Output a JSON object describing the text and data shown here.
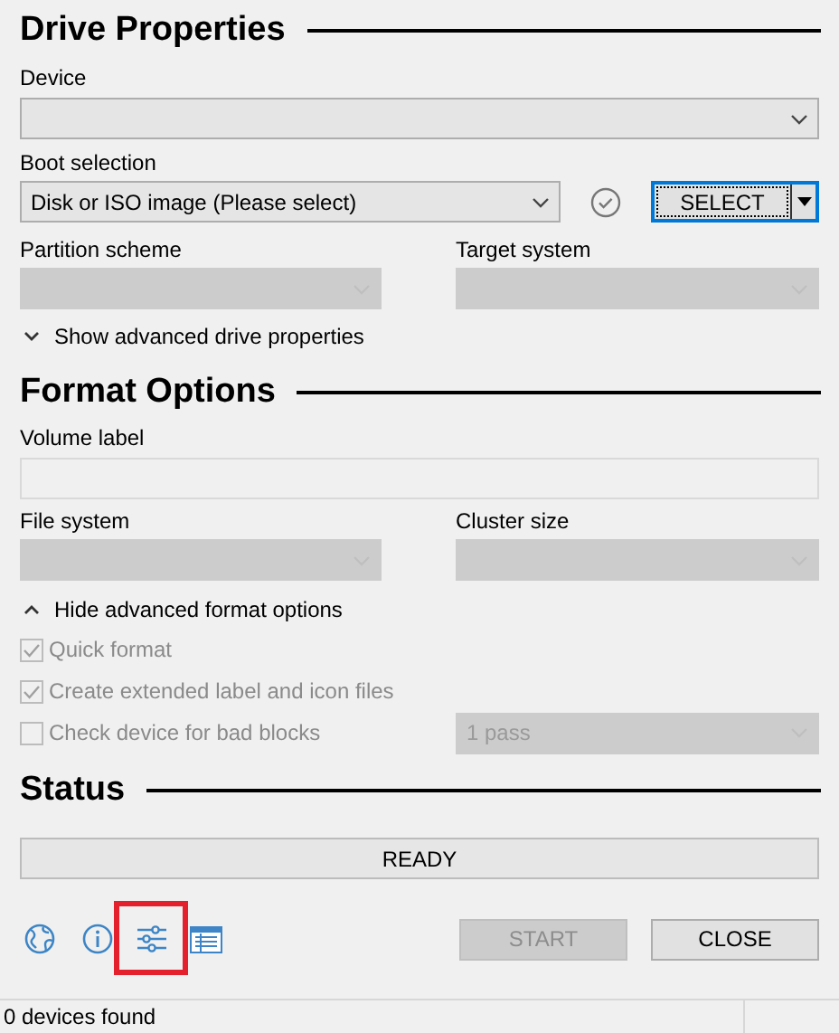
{
  "drive_properties": {
    "title": "Drive Properties",
    "device": {
      "label": "Device",
      "disabled": false
    },
    "boot_selection": {
      "label": "Boot selection",
      "value": "Disk or ISO image (Please select)",
      "disabled": false
    },
    "select_button": {
      "label": "SELECT",
      "focused": true
    },
    "partition_scheme": {
      "label": "Partition scheme",
      "disabled": true
    },
    "target_system": {
      "label": "Target system",
      "disabled": true
    },
    "advanced_toggle": {
      "label": "Show advanced drive properties",
      "expanded": false
    }
  },
  "format_options": {
    "title": "Format Options",
    "volume_label": {
      "label": "Volume label"
    },
    "file_system": {
      "label": "File system",
      "disabled": true
    },
    "cluster_size": {
      "label": "Cluster size",
      "disabled": true
    },
    "advanced_toggle": {
      "label": "Hide advanced format options",
      "expanded": true
    },
    "checkboxes": [
      {
        "label": "Quick format",
        "checked": true,
        "disabled": true
      },
      {
        "label": "Create extended label and icon files",
        "checked": true,
        "disabled": true
      },
      {
        "label": "Check device for bad blocks",
        "checked": false,
        "disabled": true
      }
    ],
    "passes": {
      "value": "1 pass",
      "disabled": true
    }
  },
  "status": {
    "title": "Status",
    "progress_text": "READY"
  },
  "toolbar": [
    {
      "kind": "globe"
    },
    {
      "kind": "info"
    },
    {
      "kind": "settings",
      "highlighted": true
    },
    {
      "kind": "log"
    }
  ],
  "buttons": [
    {
      "label": "START",
      "disabled": true
    },
    {
      "label": "CLOSE",
      "disabled": false
    }
  ],
  "status_bar": {
    "text": "0 devices found"
  }
}
